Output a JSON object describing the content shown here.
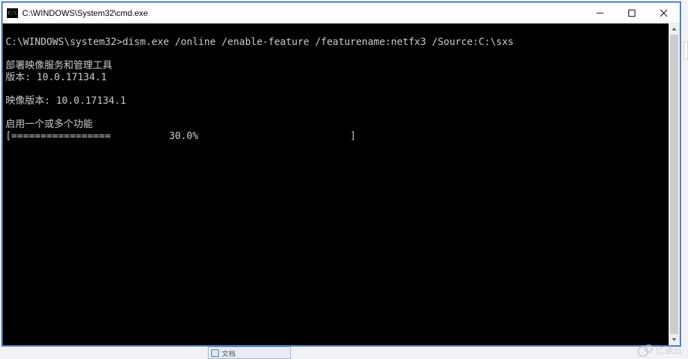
{
  "window": {
    "title": "C:\\WINDOWS\\System32\\cmd.exe"
  },
  "terminal": {
    "prompt": "C:\\WINDOWS\\system32>",
    "command": "dism.exe /online /enable-feature /featurename:netfx3 /Source:C:\\sxs",
    "lines": {
      "l1": "部署映像服务和管理工具",
      "l2": "版本: 10.0.17134.1",
      "l3": "映像版本: 10.0.17134.1",
      "l4": "启用一个或多个功能"
    },
    "progress_bar": "[=================          30.0%                          ]"
  },
  "taskbar": {
    "item": "文档"
  },
  "watermark": {
    "text": "亿速云"
  }
}
